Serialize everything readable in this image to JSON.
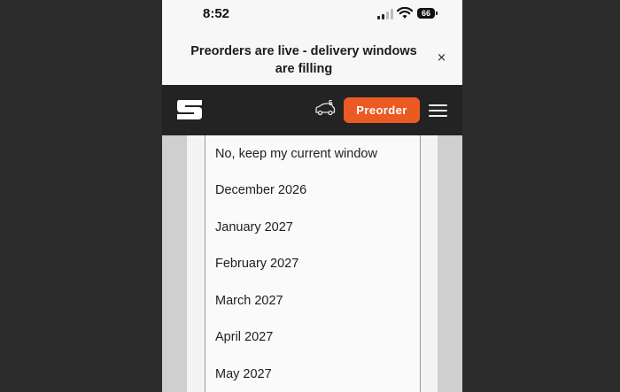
{
  "status_bar": {
    "time": "8:52",
    "battery": "66",
    "icons": [
      "signal-icon",
      "wifi-icon",
      "battery-icon"
    ]
  },
  "banner": {
    "text": "Preorders are live - delivery windows are filling",
    "close_symbol": "×"
  },
  "header": {
    "logo_icon": "brand-logo-icon",
    "car_count": "5",
    "preorder_label": "Preorder",
    "accent_color": "#ec5a24",
    "menu_icon": "hamburger-menu-icon"
  },
  "dropdown": {
    "options": [
      "No, keep my current window",
      "December 2026",
      "January 2027",
      "February 2027",
      "March 2027",
      "April 2027",
      "May 2027"
    ]
  }
}
